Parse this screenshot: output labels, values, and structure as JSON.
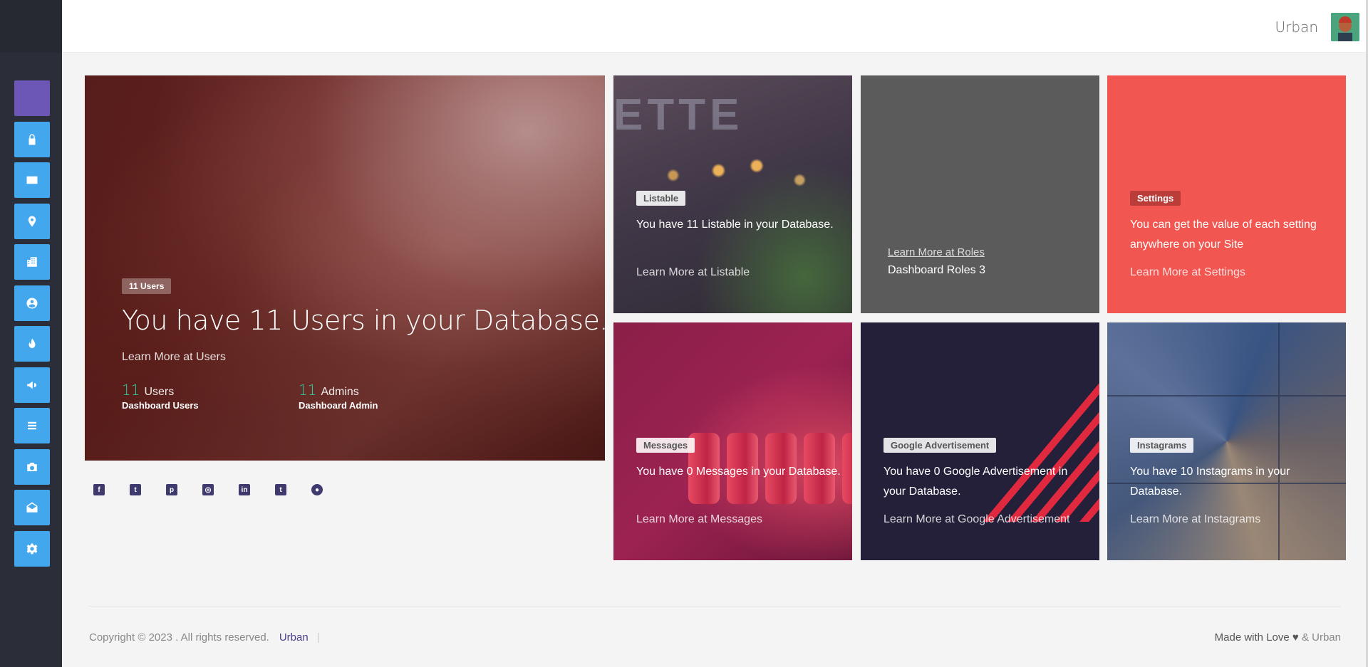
{
  "header": {
    "user_name": "Urban"
  },
  "sidebar": {
    "items": [
      {
        "icon": "home-icon"
      },
      {
        "icon": "lock-icon"
      },
      {
        "icon": "id-card-icon"
      },
      {
        "icon": "map-marker-icon"
      },
      {
        "icon": "building-icon"
      },
      {
        "icon": "user-circle-icon"
      },
      {
        "icon": "fire-icon"
      },
      {
        "icon": "megaphone-icon"
      },
      {
        "icon": "list-icon"
      },
      {
        "icon": "camera-icon"
      },
      {
        "icon": "envelope-open-icon"
      },
      {
        "icon": "gear-icon"
      }
    ]
  },
  "hero": {
    "tag": "11 Users",
    "headline": "You have 11 Users in your Database.",
    "learn_more": "Learn More at Users",
    "stats": [
      {
        "value": "11",
        "label": "Users",
        "sub": "Dashboard Users"
      },
      {
        "value": "11",
        "label": "Admins",
        "sub": "Dashboard Admin"
      }
    ]
  },
  "social": [
    "facebook-icon",
    "twitter-icon",
    "pinterest-icon",
    "instagram-icon",
    "linkedin-icon",
    "tumblr-icon",
    "github-icon"
  ],
  "cards": {
    "listable": {
      "tag": "Listable",
      "text": "You have 11 Listable in your Database.",
      "link": "Learn More at Listable"
    },
    "roles": {
      "link": "Learn More at Roles",
      "text": "Dashboard Roles 3"
    },
    "settings": {
      "tag": "Settings",
      "text": "You can get the value of each setting anywhere on your Site",
      "link": "Learn More at Settings"
    },
    "messages": {
      "tag": "Messages",
      "text": "You have 0 Messages in your Database.",
      "link": "Learn More at Messages"
    },
    "google_ads": {
      "tag": "Google Advertisement",
      "text": "You have 0 Google Advertisement in your Database.",
      "link": "Learn More at Google Advertisement"
    },
    "instagrams": {
      "tag": "Instagrams",
      "text": "You have 10 Instagrams in your Database.",
      "link": "Learn More at Instagrams"
    }
  },
  "footer": {
    "copyright": "Copyright © 2023 . All rights reserved.",
    "brand": "Urban",
    "separator": "|",
    "made_with": "Made with Love",
    "by": "& Urban"
  },
  "colors": {
    "sidebar_bg": "#2b2e38",
    "nav_blue": "#43a7ee",
    "nav_purple": "#6c57b6",
    "accent_green": "#27d3a1",
    "settings_red": "#f25650",
    "roles_gray": "#5b5b5b"
  }
}
